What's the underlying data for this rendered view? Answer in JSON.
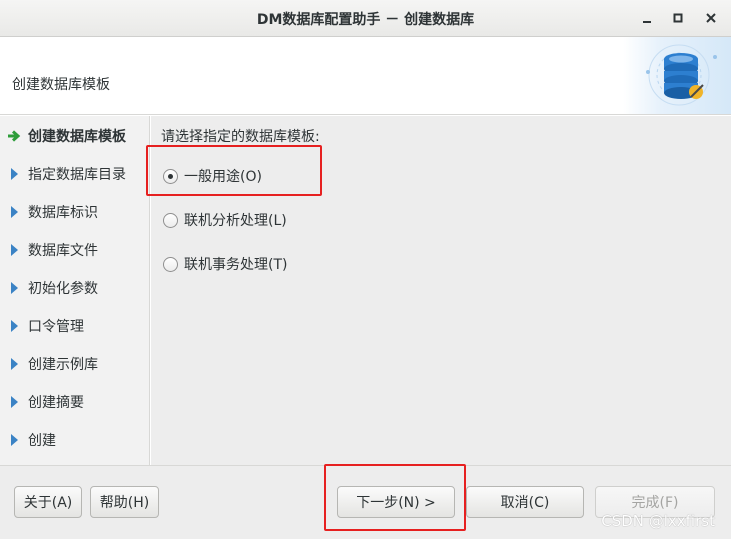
{
  "window": {
    "title": "DM数据库配置助手 － 创建数据库",
    "minimize_glyph": "–",
    "maximize_glyph": "▫",
    "close_glyph": "✕"
  },
  "header": {
    "title": "创建数据库模板",
    "logo_icon": "database-config-icon"
  },
  "sidebar": {
    "items": [
      {
        "label": "创建数据库模板",
        "active": true,
        "icon": "green-arrow-icon"
      },
      {
        "label": "指定数据库目录",
        "active": false,
        "icon": "triangle-right-icon"
      },
      {
        "label": "数据库标识",
        "active": false,
        "icon": "triangle-right-icon"
      },
      {
        "label": "数据库文件",
        "active": false,
        "icon": "triangle-right-icon"
      },
      {
        "label": "初始化参数",
        "active": false,
        "icon": "triangle-right-icon"
      },
      {
        "label": "口令管理",
        "active": false,
        "icon": "triangle-right-icon"
      },
      {
        "label": "创建示例库",
        "active": false,
        "icon": "triangle-right-icon"
      },
      {
        "label": "创建摘要",
        "active": false,
        "icon": "triangle-right-icon"
      },
      {
        "label": "创建",
        "active": false,
        "icon": "triangle-right-icon"
      }
    ]
  },
  "main": {
    "prompt": "请选择指定的数据库模板:",
    "options": [
      {
        "label": "一般用途(O)",
        "selected": true
      },
      {
        "label": "联机分析处理(L)",
        "selected": false
      },
      {
        "label": "联机事务处理(T)",
        "selected": false
      }
    ]
  },
  "footer": {
    "about_label": "关于(A)",
    "help_label": "帮助(H)",
    "next_label": "下一步(N) >",
    "cancel_label": "取消(C)",
    "finish_label": "完成(F)"
  },
  "watermark": "CSDN @lxxfirst",
  "colors": {
    "highlight_box": "#e62020",
    "active_arrow": "#2e9d3a",
    "sidebar_triangle": "#3b83c5"
  }
}
